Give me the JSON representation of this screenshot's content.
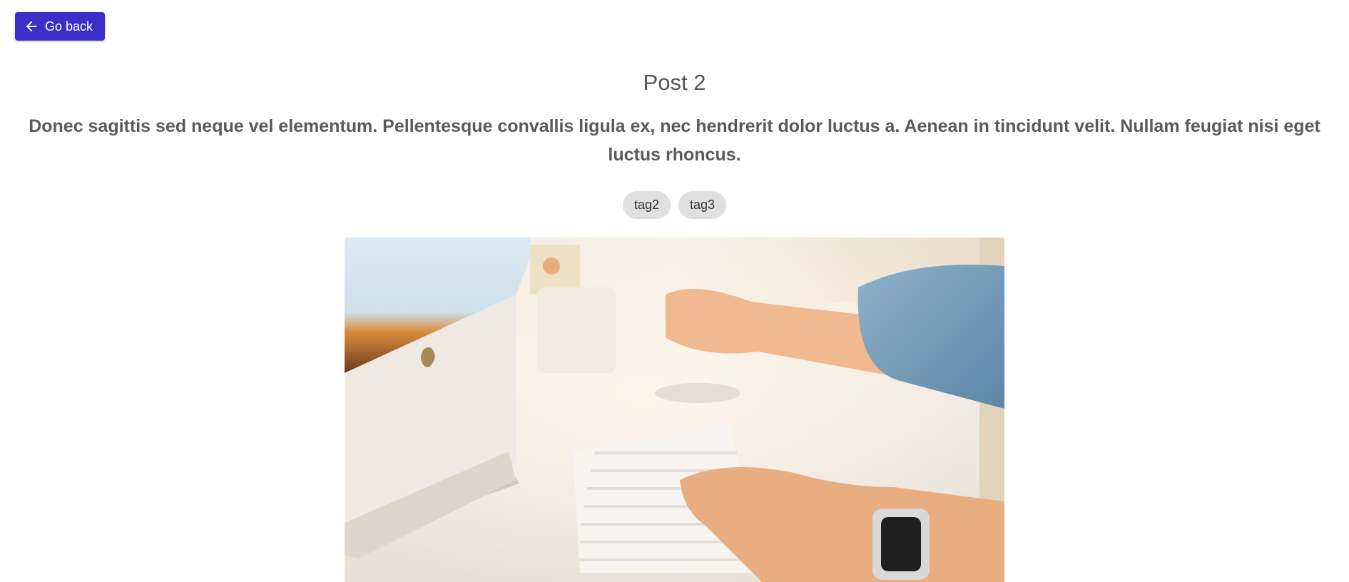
{
  "back_button": {
    "label": "Go back",
    "icon": "arrow-left-icon"
  },
  "post": {
    "title": "Post 2",
    "summary": "Donec sagittis sed neque vel elementum. Pellentesque convallis ligula ex, nec hendrerit dolor luctus a. Aenean in tincidunt velit. Nullam feugiat nisi eget luctus rhoncus.",
    "tags": [
      "tag2",
      "tag3"
    ]
  },
  "colors": {
    "primary": "#3b2fc9",
    "tag_bg": "#e0e0e0",
    "text_muted": "#555555"
  }
}
